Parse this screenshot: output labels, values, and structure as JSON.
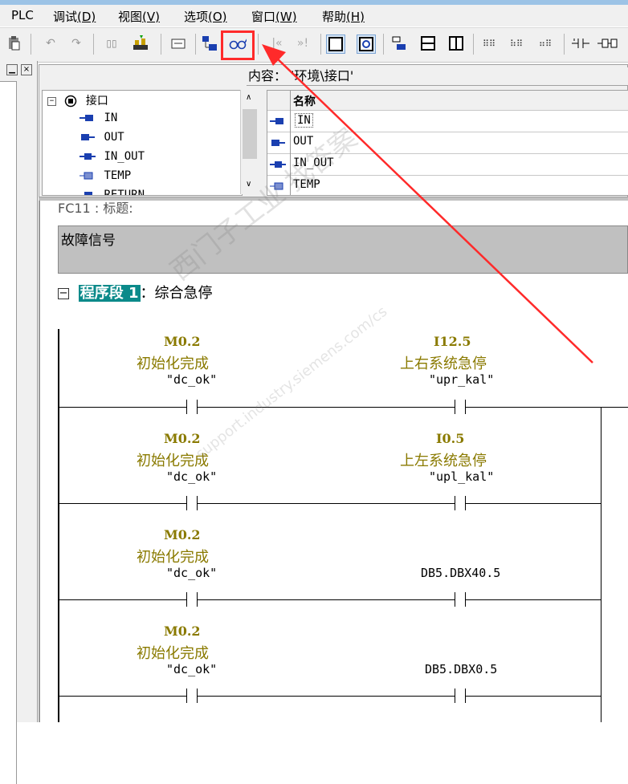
{
  "menu": {
    "items": [
      {
        "label": "PLC",
        "accel": ""
      },
      {
        "label": "调试",
        "accel": "(D)"
      },
      {
        "label": "视图",
        "accel": "(V)"
      },
      {
        "label": "选项",
        "accel": "(O)"
      },
      {
        "label": "窗口",
        "accel": "(W)"
      },
      {
        "label": "帮助",
        "accel": "(H)"
      }
    ]
  },
  "toolbar": {
    "icons": [
      "paste-icon",
      "undo-icon",
      "redo-icon",
      "compare-icon",
      "download-icon",
      "open-block-icon",
      "monitor-status-icon",
      "monitor-glasses-icon",
      "prev-icon",
      "next-icon",
      "ladder-view-icon",
      "zoom-view-icon",
      "network-icon",
      "block-list-icon",
      "columns-icon",
      "symbol-icon",
      "tree-icon",
      "detail-icon",
      "contact-icon",
      "coil-icon"
    ],
    "prev_label": "|«",
    "next_label": "»!"
  },
  "interface": {
    "path_label": "内容： '环境\\接口'",
    "tree_root": "接口",
    "tree_items": [
      "IN",
      "OUT",
      "IN_OUT",
      "TEMP",
      "RETURN"
    ],
    "list_header": "名称",
    "list_items": [
      "IN",
      "OUT",
      "IN_OUT",
      "TEMP"
    ]
  },
  "editor": {
    "fc_title": "FC11 : 标题:",
    "block_comment": "故障信号",
    "network_label": "程序段 1",
    "network_title": "：综合急停",
    "rungs": [
      {
        "left_addr": "M0.2",
        "left_comment": "初始化完成",
        "left_symbol": "\"dc_ok\"",
        "right_addr": "I12.5",
        "right_comment": "上右系统急停",
        "right_symbol": "\"upr_kal\"",
        "right_plain": ""
      },
      {
        "left_addr": "M0.2",
        "left_comment": "初始化完成",
        "left_symbol": "\"dc_ok\"",
        "right_addr": "I0.5",
        "right_comment": "上左系统急停",
        "right_symbol": "\"upl_kal\"",
        "right_plain": ""
      },
      {
        "left_addr": "M0.2",
        "left_comment": "初始化完成",
        "left_symbol": "\"dc_ok\"",
        "right_addr": "",
        "right_comment": "",
        "right_symbol": "",
        "right_plain": "DB5.DBX40.5"
      },
      {
        "left_addr": "M0.2",
        "left_comment": "初始化完成",
        "left_symbol": "\"dc_ok\"",
        "right_addr": "",
        "right_comment": "",
        "right_symbol": "",
        "right_plain": "DB5.DBX0.5"
      }
    ]
  },
  "watermark": {
    "line1": "西门子工业   找答案",
    "line2": "support.industry.siemens.com/cs"
  },
  "colors": {
    "highlight": "#ff2a2a",
    "network_label_bg": "#0b8a8a",
    "operand_color": "#8a7a00"
  }
}
